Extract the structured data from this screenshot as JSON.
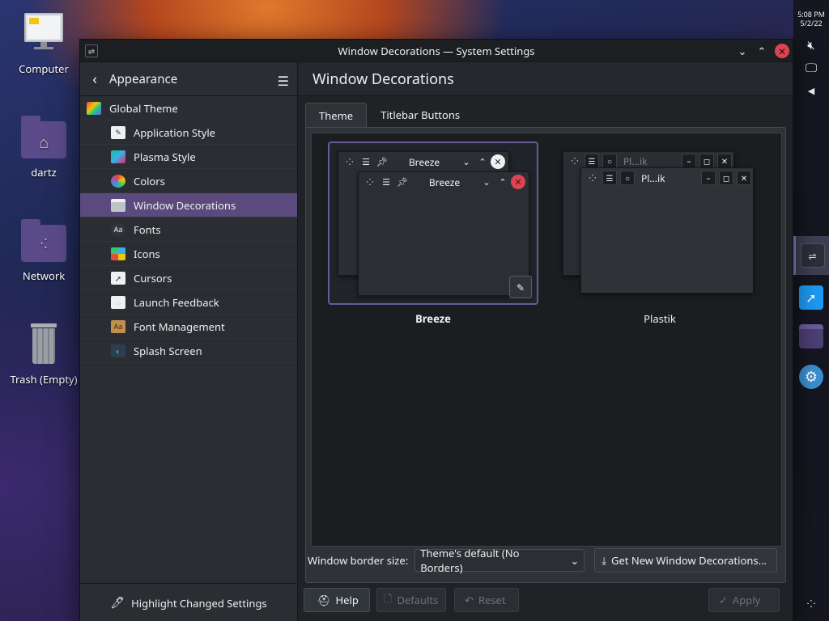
{
  "desktop": {
    "icons": [
      {
        "label": "Computer",
        "icon": "computer-icon"
      },
      {
        "label": "dartz",
        "icon": "home-folder-icon"
      },
      {
        "label": "Network",
        "icon": "network-folder-icon"
      },
      {
        "label": "Trash (Empty)",
        "icon": "trash-icon"
      }
    ]
  },
  "panel": {
    "time": "5:08 PM",
    "date": "5/2/22"
  },
  "window": {
    "title": "Window Decorations — System Settings",
    "controls": {
      "minimize": "⌄",
      "maximize": "⌃",
      "close": "✕"
    }
  },
  "sidebar": {
    "title": "Appearance",
    "items": [
      {
        "label": "Global Theme",
        "icon": "global-theme-icon",
        "indent": false,
        "selected": false,
        "color": "#e74c3c"
      },
      {
        "label": "Application Style",
        "icon": "application-style-icon",
        "indent": true,
        "selected": false,
        "color": "#ecf0f1"
      },
      {
        "label": "Plasma Style",
        "icon": "plasma-style-icon",
        "indent": true,
        "selected": false,
        "color": "#1abc9c"
      },
      {
        "label": "Colors",
        "icon": "colors-icon",
        "indent": true,
        "selected": false,
        "color": "#f39c1f"
      },
      {
        "label": "Window Decorations",
        "icon": "window-decorations-icon",
        "indent": true,
        "selected": true,
        "color": "#bdc3c7"
      },
      {
        "label": "Fonts",
        "icon": "fonts-icon",
        "indent": true,
        "selected": false,
        "color": "#31363b"
      },
      {
        "label": "Icons",
        "icon": "icons-icon",
        "indent": true,
        "selected": false,
        "color": "#95a5a6"
      },
      {
        "label": "Cursors",
        "icon": "cursors-icon",
        "indent": true,
        "selected": false,
        "color": "#eff0f1"
      },
      {
        "label": "Launch Feedback",
        "icon": "launch-feedback-icon",
        "indent": true,
        "selected": false,
        "color": "#eff0f1"
      },
      {
        "label": "Font Management",
        "icon": "font-management-icon",
        "indent": true,
        "selected": false,
        "color": "#c0914e"
      },
      {
        "label": "Splash Screen",
        "icon": "splash-screen-icon",
        "indent": true,
        "selected": false,
        "color": "#2c3e50"
      }
    ],
    "footer_label": "Highlight Changed Settings"
  },
  "content": {
    "title": "Window Decorations",
    "tabs": [
      {
        "label": "Theme",
        "active": true
      },
      {
        "label": "Titlebar Buttons",
        "active": false
      }
    ],
    "themes": [
      {
        "name": "Breeze",
        "selected": true,
        "back_title": "Breeze",
        "front_title": "Breeze"
      },
      {
        "name": "Plastik",
        "selected": false,
        "back_title": "Pl...ik",
        "front_title": "Pl...ik"
      }
    ],
    "border_size_label": "Window border size:",
    "border_size_value": "Theme's default (No Borders)",
    "get_new_label": "Get New Window Decorations..."
  },
  "buttons": {
    "help": "Help",
    "defaults": "Defaults",
    "reset": "Reset",
    "apply": "Apply"
  },
  "colors": {
    "accent": "#5b4a7d",
    "selection_border": "#6a5a95",
    "close_red": "#da4453"
  }
}
